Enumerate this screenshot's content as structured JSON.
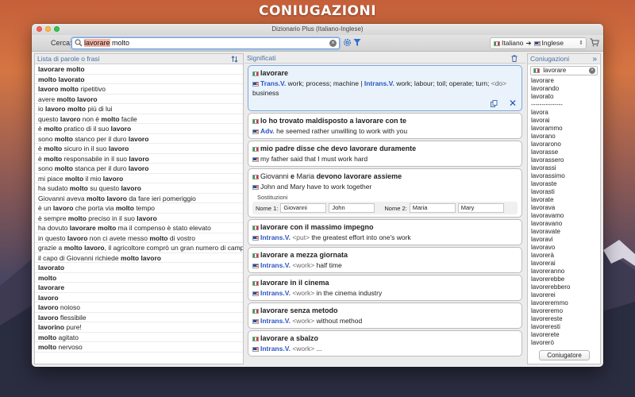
{
  "promo_title": "CONIUGAZIONI",
  "window": {
    "title": "Dizionario Plus (Italiano-Inglese)"
  },
  "toolbar": {
    "search_label": "Cerca:",
    "query_highlight": "lavorare",
    "query_rest": " molto",
    "source_lang": "Italiano",
    "arrow": "➔",
    "target_lang": "Inglese"
  },
  "word_list": {
    "header": "Lista di parole o frasi",
    "items": [
      [
        [
          "b",
          "lavorare molto"
        ]
      ],
      [
        [
          "b",
          "molto lavorato"
        ]
      ],
      [
        [
          "b",
          "lavoro molto"
        ],
        [
          "t",
          " ripetitivo"
        ]
      ],
      [
        [
          "t",
          "avere "
        ],
        [
          "b",
          "molto lavoro"
        ]
      ],
      [
        [
          "t",
          "io "
        ],
        [
          "b",
          "lavoro molto"
        ],
        [
          "t",
          " più di lui"
        ]
      ],
      [
        [
          "t",
          "questo "
        ],
        [
          "b",
          "lavoro"
        ],
        [
          "t",
          " non è "
        ],
        [
          "b",
          "molto"
        ],
        [
          "t",
          " facile"
        ]
      ],
      [
        [
          "t",
          "è "
        ],
        [
          "b",
          "molto"
        ],
        [
          "t",
          " pratico di il suo "
        ],
        [
          "b",
          "lavoro"
        ]
      ],
      [
        [
          "t",
          "sono "
        ],
        [
          "b",
          "molto"
        ],
        [
          "t",
          " stanco per il duro "
        ],
        [
          "b",
          "lavoro"
        ]
      ],
      [
        [
          "t",
          "è "
        ],
        [
          "b",
          "molto"
        ],
        [
          "t",
          " sicuro in il suo "
        ],
        [
          "b",
          "lavoro"
        ]
      ],
      [
        [
          "t",
          "è "
        ],
        [
          "b",
          "molto"
        ],
        [
          "t",
          " responsabile in il suo "
        ],
        [
          "b",
          "lavoro"
        ]
      ],
      [
        [
          "t",
          "sono "
        ],
        [
          "b",
          "molto"
        ],
        [
          "t",
          " stanca per il duro "
        ],
        [
          "b",
          "lavoro"
        ]
      ],
      [
        [
          "t",
          "mi piace "
        ],
        [
          "b",
          "molto"
        ],
        [
          "t",
          " il mio "
        ],
        [
          "b",
          "lavoro"
        ]
      ],
      [
        [
          "t",
          "ha sudato "
        ],
        [
          "b",
          "molto"
        ],
        [
          "t",
          " su questo "
        ],
        [
          "b",
          "lavoro"
        ]
      ],
      [
        [
          "t",
          "Giovanni aveva "
        ],
        [
          "b",
          "molto lavoro"
        ],
        [
          "t",
          " da fare ieri pomeriggio"
        ]
      ],
      [
        [
          "t",
          "è un "
        ],
        [
          "b",
          "lavoro"
        ],
        [
          "t",
          " che porta via "
        ],
        [
          "b",
          "molto"
        ],
        [
          "t",
          " tempo"
        ]
      ],
      [
        [
          "t",
          "è sempre "
        ],
        [
          "b",
          "molto"
        ],
        [
          "t",
          " preciso in il suo "
        ],
        [
          "b",
          "lavoro"
        ]
      ],
      [
        [
          "t",
          "ha dovuto "
        ],
        [
          "b",
          "lavorare molto"
        ],
        [
          "t",
          " ma il compenso è stato elevato"
        ]
      ],
      [
        [
          "t",
          "in questo "
        ],
        [
          "b",
          "lavoro"
        ],
        [
          "t",
          " non ci avete messo "
        ],
        [
          "b",
          "molto"
        ],
        [
          "t",
          " di vostro"
        ]
      ],
      [
        [
          "t",
          "grazie a "
        ],
        [
          "b",
          "molto lavoro"
        ],
        [
          "t",
          ", il agricoltore comprò un gran numero di campi"
        ]
      ],
      [
        [
          "t",
          "il capo di Giovanni richiede "
        ],
        [
          "b",
          "molto lavoro"
        ]
      ],
      [
        [
          "b",
          "lavorato"
        ]
      ],
      [
        [
          "b",
          "molto"
        ]
      ],
      [
        [
          "b",
          "lavorare"
        ]
      ],
      [
        [
          "b",
          "lavoro"
        ]
      ],
      [
        [
          "b",
          "lavoro"
        ],
        [
          "t",
          " noioso"
        ]
      ],
      [
        [
          "b",
          "lavoro"
        ],
        [
          "t",
          " flessibile"
        ]
      ],
      [
        [
          "b",
          "lavorino"
        ],
        [
          "t",
          " pure!"
        ]
      ],
      [
        [
          "b",
          "molto"
        ],
        [
          "t",
          " agitato"
        ]
      ],
      [
        [
          "b",
          "molto"
        ],
        [
          "t",
          " nervoso"
        ]
      ]
    ]
  },
  "meanings": {
    "header": "Significati",
    "cards": [
      {
        "selected": true,
        "head": [
          [
            "b",
            "lavorare"
          ]
        ],
        "lines": [
          [
            [
              "pos",
              "Trans.V."
            ],
            [
              "t",
              " work; process; machine | "
            ],
            [
              "pos",
              "Intrans.V."
            ],
            [
              "t",
              " work; labour; toil; operate; turn; "
            ],
            [
              "tag",
              "<do>"
            ],
            [
              "t",
              " business"
            ]
          ]
        ]
      },
      {
        "head": [
          [
            "b",
            "lo ho trovato maldisposto a lavorare con te"
          ]
        ],
        "lines": [
          [
            [
              "pos",
              "Adv."
            ],
            [
              "t",
              " he seemed rather unwilling to work with you"
            ]
          ]
        ]
      },
      {
        "head": [
          [
            "b",
            "mio padre disse che devo lavorare duramente"
          ]
        ],
        "lines": [
          [
            [
              "t",
              "my father said that I must work hard"
            ]
          ]
        ]
      },
      {
        "subs": true,
        "head": [
          [
            "n",
            "Giovanni"
          ],
          [
            "b",
            " e "
          ],
          [
            "n",
            "Maria"
          ],
          [
            "b",
            " devono lavorare assieme"
          ]
        ],
        "lines": [
          [
            [
              "n",
              "John"
            ],
            [
              "t",
              " and "
            ],
            [
              "n",
              "Mary"
            ],
            [
              "t",
              " have to work together"
            ]
          ]
        ],
        "subs_title": "Sostituzioni",
        "name1_label": "Nome 1:",
        "name1_it": "Giovanni",
        "name1_en": "John",
        "name2_label": "Nome 2:",
        "name2_it": "Maria",
        "name2_en": "Mary"
      },
      {
        "head": [
          [
            "b",
            "lavorare con il massimo impegno"
          ]
        ],
        "lines": [
          [
            [
              "pos",
              "Intrans.V."
            ],
            [
              "tag",
              " <put>"
            ],
            [
              "t",
              " the greatest effort into one's work"
            ]
          ]
        ]
      },
      {
        "head": [
          [
            "b",
            "lavorare a mezza giornata"
          ]
        ],
        "lines": [
          [
            [
              "pos",
              "Intrans.V."
            ],
            [
              "tag",
              " <work>"
            ],
            [
              "t",
              " half time"
            ]
          ]
        ]
      },
      {
        "head": [
          [
            "b",
            "lavorare in il cinema"
          ]
        ],
        "lines": [
          [
            [
              "pos",
              "Intrans.V."
            ],
            [
              "tag",
              " <work>"
            ],
            [
              "t",
              " in the cinema industry"
            ]
          ]
        ]
      },
      {
        "head": [
          [
            "b",
            "lavorare senza metodo"
          ]
        ],
        "lines": [
          [
            [
              "pos",
              "Intrans.V."
            ],
            [
              "tag",
              " <work>"
            ],
            [
              "t",
              " without method"
            ]
          ]
        ]
      },
      {
        "head": [
          [
            "b",
            "lavorare a sbalzo"
          ]
        ],
        "lines": [
          [
            [
              "pos",
              "Intrans.V."
            ],
            [
              "tag",
              " <work>"
            ],
            [
              "t",
              " ..."
            ]
          ]
        ]
      }
    ]
  },
  "conjugations": {
    "header": "Coniugazioni",
    "input": "lavorare",
    "forms": [
      "lavorare",
      "lavorando",
      "lavorato",
      "---------------",
      "lavora",
      "lavorai",
      "lavorammo",
      "lavorano",
      "lavorarono",
      "lavorasse",
      "lavorassero",
      "lavorassi",
      "lavorassimo",
      "lavoraste",
      "lavorasti",
      "lavorate",
      "lavorava",
      "lavoravamo",
      "lavoravano",
      "lavoravate",
      "lavoravi",
      "lavoravo",
      "lavorerà",
      "lavorerai",
      "lavoreranno",
      "lavorerebbe",
      "lavorerebbero",
      "lavorerei",
      "lavoreremmo",
      "lavoreremo",
      "lavorereste",
      "lavoreresti",
      "lavorerete",
      "lavorerò"
    ],
    "button": "Coniugatore"
  }
}
